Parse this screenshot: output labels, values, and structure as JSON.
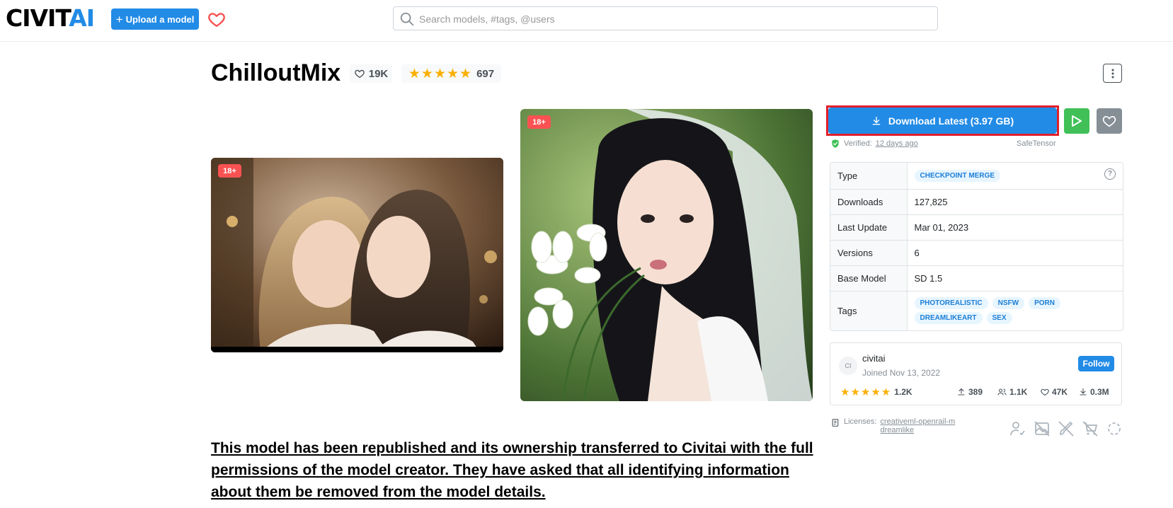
{
  "header": {
    "logo_left": "CIVIT",
    "logo_right": "AI",
    "upload_label": "Upload a model",
    "search_placeholder": "Search models, #tags, @users"
  },
  "model": {
    "title": "ChilloutMix",
    "likes": "19K",
    "rating_count": "697",
    "stars": "★★★★★"
  },
  "images": [
    {
      "badge": "18+"
    },
    {
      "badge": "18+"
    }
  ],
  "download": {
    "label": "Download Latest (3.97 GB)",
    "verified_label": "Verified:",
    "verified_when": "12 days ago",
    "format": "SafeTensor"
  },
  "details": {
    "rows": [
      {
        "label": "Type",
        "value": "CHECKPOINT MERGE"
      },
      {
        "label": "Downloads",
        "value": "127,825"
      },
      {
        "label": "Last Update",
        "value": "Mar 01, 2023"
      },
      {
        "label": "Versions",
        "value": "6"
      },
      {
        "label": "Base Model",
        "value": "SD 1.5"
      },
      {
        "label": "Tags",
        "value": ""
      }
    ],
    "tags": [
      "PHOTOREALISTIC",
      "NSFW",
      "PORN",
      "DREAMLIKEART",
      "SEX"
    ]
  },
  "creator": {
    "initials": "CI",
    "name": "civitai",
    "joined": "Joined Nov 13, 2022",
    "follow_label": "Follow",
    "rating": "1.2K",
    "uploads": "389",
    "followers": "1.1K",
    "favorites": "47K",
    "downloads": "0.3M"
  },
  "licenses": {
    "label": "Licenses:",
    "items": [
      "creativeml-openrail-m",
      "dreamlike"
    ]
  },
  "notice": "This model has been republished and its ownership transferred to Civitai with the full permissions of the model creator. They have asked that all identifying information about them be removed from the model details.",
  "colors": {
    "primary": "#228be6",
    "run": "#40c057",
    "star": "#fab005",
    "nsfw": "#fa5252",
    "highlight": "#e0202c"
  }
}
